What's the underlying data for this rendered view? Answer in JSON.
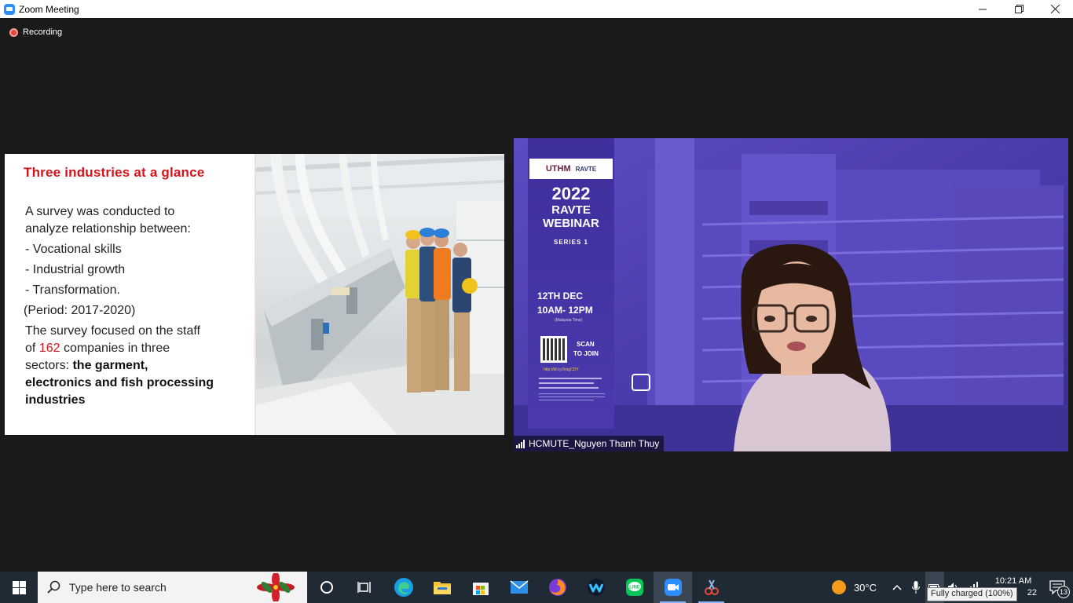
{
  "window": {
    "title": "Zoom Meeting"
  },
  "recording": {
    "label": "Recording"
  },
  "slide": {
    "title": "Three industries at a glance",
    "line1": "A survey was conducted to",
    "line2": "analyze relationship between:",
    "item1": "- Vocational skills",
    "item2": "- Industrial growth",
    "item3": "- Transformation.",
    "period": "(Period: 2017-2020)",
    "focus_a": "The survey focused on the staff",
    "focus_b_pre": "of ",
    "focus_b_num": "162",
    "focus_b_post": " companies in three",
    "focus_c_pre": "sectors: ",
    "focus_c_bold": "the garment,",
    "focus_d": "electronics and fish processing",
    "focus_e": "industries"
  },
  "video": {
    "participant_name": "HCMUTE_Nguyen Thanh Thuy",
    "poster": {
      "logo": "UTHM",
      "logo2": "RAVTE",
      "year": "2022",
      "title1": "RAVTE",
      "title2": "WEBINAR",
      "series": "SERIES 1",
      "date": "12TH DEC",
      "time": "10AM- 12PM",
      "timezone": "(Malaysia Time)",
      "scan1": "SCAN",
      "scan2": "TO JOIN",
      "link": "http://bit.ly/3ragCDY"
    },
    "building_sign": "UTHM",
    "colors": {
      "overlay": "#4a3aa8"
    }
  },
  "taskbar": {
    "search_placeholder": "Type here to search",
    "temperature": "30°C",
    "time": "10:21 AM",
    "date_partial": "22",
    "notification_count": "13",
    "battery_tooltip": "Fully charged (100%)",
    "apps": [
      "task-view",
      "edge",
      "file-explorer",
      "microsoft-store",
      "mail",
      "firefox",
      "webex",
      "line",
      "zoom",
      "snipping-tool"
    ]
  }
}
